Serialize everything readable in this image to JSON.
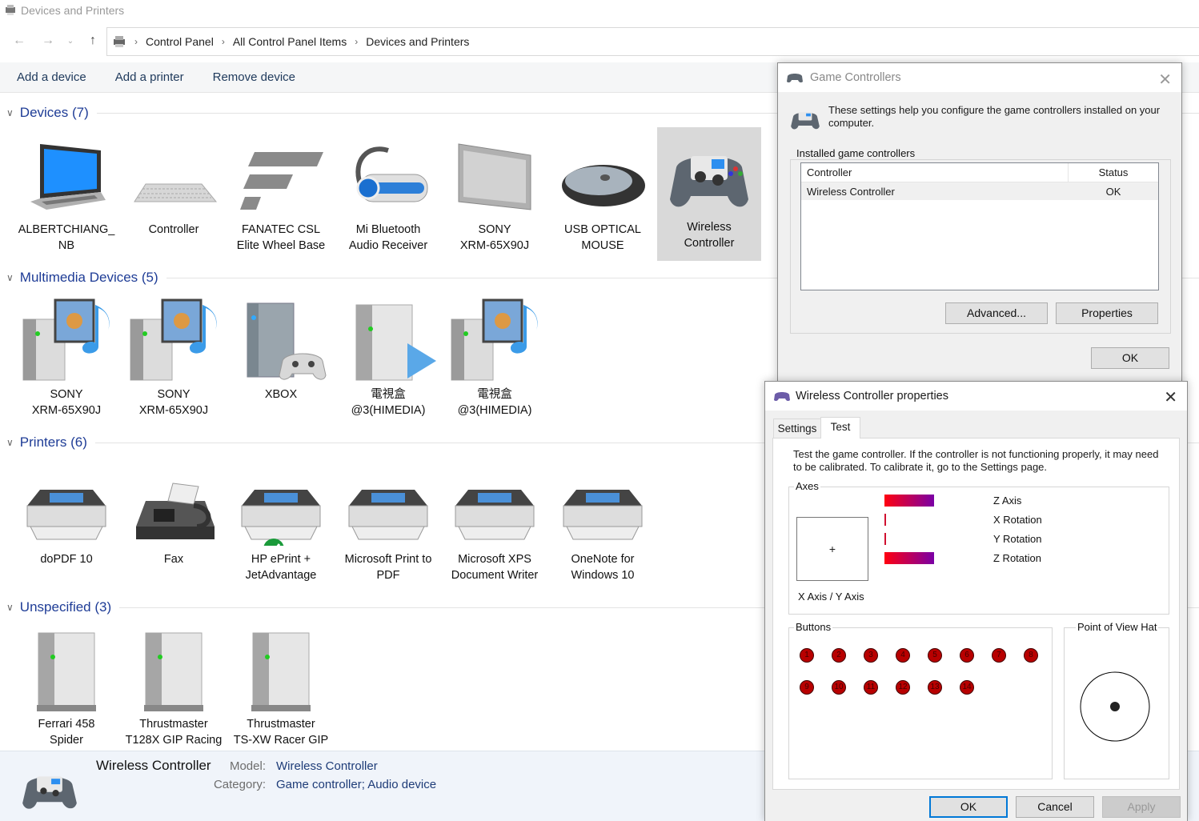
{
  "window": {
    "title": "Devices and Printers"
  },
  "address": {
    "crumbs": [
      "Control Panel",
      "All Control Panel Items",
      "Devices and Printers"
    ]
  },
  "commands": [
    "Add a device",
    "Add a printer",
    "Remove device"
  ],
  "groups": {
    "devices": {
      "title": "Devices (7)",
      "items": [
        {
          "l1": "ALBERTCHIANG_",
          "l2": "NB"
        },
        {
          "l1": "Controller",
          "l2": ""
        },
        {
          "l1": "FANATEC CSL",
          "l2": "Elite Wheel Base"
        },
        {
          "l1": "Mi Bluetooth",
          "l2": "Audio Receiver"
        },
        {
          "l1": "SONY",
          "l2": "XRM-65X90J"
        },
        {
          "l1": "USB OPTICAL",
          "l2": "MOUSE"
        },
        {
          "l1": "Wireless",
          "l2": "Controller"
        }
      ]
    },
    "multimedia": {
      "title": "Multimedia Devices (5)",
      "items": [
        {
          "l1": "SONY",
          "l2": "XRM-65X90J"
        },
        {
          "l1": "SONY",
          "l2": "XRM-65X90J"
        },
        {
          "l1": "XBOX",
          "l2": ""
        },
        {
          "l1": "電視盒",
          "l2": "@3(HIMEDIA)"
        },
        {
          "l1": "電視盒",
          "l2": "@3(HIMEDIA)"
        }
      ]
    },
    "printers": {
      "title": "Printers (6)",
      "items": [
        {
          "l1": "doPDF 10",
          "l2": ""
        },
        {
          "l1": "Fax",
          "l2": ""
        },
        {
          "l1": "HP ePrint +",
          "l2": "JetAdvantage"
        },
        {
          "l1": "Microsoft Print to",
          "l2": "PDF"
        },
        {
          "l1": "Microsoft XPS",
          "l2": "Document Writer"
        },
        {
          "l1": "OneNote for",
          "l2": "Windows 10"
        }
      ]
    },
    "unspecified": {
      "title": "Unspecified (3)",
      "items": [
        {
          "l1": "Ferrari 458",
          "l2": "Spider"
        },
        {
          "l1": "Thrustmaster",
          "l2": "T128X GIP Racing"
        },
        {
          "l1": "Thrustmaster",
          "l2": "TS-XW Racer GIP"
        }
      ]
    }
  },
  "details": {
    "name": "Wireless Controller",
    "model_key": "Model:",
    "model": "Wireless Controller",
    "category_key": "Category:",
    "category": "Game controller; Audio device"
  },
  "game_controllers": {
    "title": "Game Controllers",
    "intro": "These settings help you configure the game controllers installed on your computer.",
    "group_label": "Installed game controllers",
    "col_controller": "Controller",
    "col_status": "Status",
    "row_name": "Wireless Controller",
    "row_status": "OK",
    "advanced": "Advanced...",
    "properties": "Properties",
    "ok": "OK"
  },
  "properties_dialog": {
    "title": "Wireless Controller properties",
    "tabs": [
      "Settings",
      "Test"
    ],
    "active_tab": "Test",
    "intro": "Test the game controller.  If the controller is not functioning properly, it may need to be calibrated.  To calibrate it, go to the Settings page.",
    "axes_label": "Axes",
    "axes": [
      {
        "name": "Z Axis",
        "level": 0.5
      },
      {
        "name": "X Rotation",
        "level": 0
      },
      {
        "name": "Y Rotation",
        "level": 0
      },
      {
        "name": "Z Rotation",
        "level": 0.5
      }
    ],
    "xy_label": "X Axis / Y Axis",
    "xy_cross": "+",
    "buttons_label": "Buttons",
    "buttons": [
      "1",
      "2",
      "3",
      "4",
      "5",
      "6",
      "7",
      "8",
      "9",
      "10",
      "11",
      "12",
      "13",
      "14"
    ],
    "pov_label": "Point of View Hat",
    "ok": "OK",
    "cancel": "Cancel",
    "apply": "Apply"
  }
}
